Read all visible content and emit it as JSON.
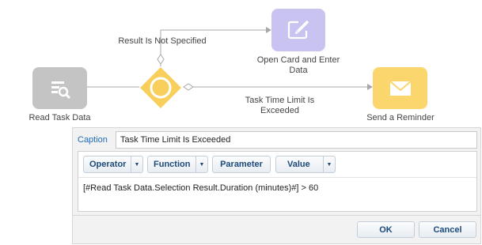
{
  "diagram": {
    "read_task_label": "Read Task Data",
    "open_card_label": "Open Card and Enter Data",
    "send_reminder_label": "Send a Reminder",
    "flow_not_specified_label": "Result Is Not Specified",
    "flow_time_limit_label": "Task Time Limit Is Exceeded",
    "colors": {
      "read_task": "#c4c4c4",
      "open_card": "#c8c3f0",
      "gateway": "#f8cf5a",
      "send_reminder": "#fbd66c"
    }
  },
  "editor": {
    "caption_label": "Caption",
    "caption_value": "Task Time Limit Is Exceeded",
    "toolbar": {
      "operator": "Operator",
      "function": "Function",
      "parameter": "Parameter",
      "value": "Value"
    },
    "expression": "[#Read Task Data.Selection Result.Duration (minutes)#] > 60",
    "ok_label": "OK",
    "cancel_label": "Cancel"
  }
}
